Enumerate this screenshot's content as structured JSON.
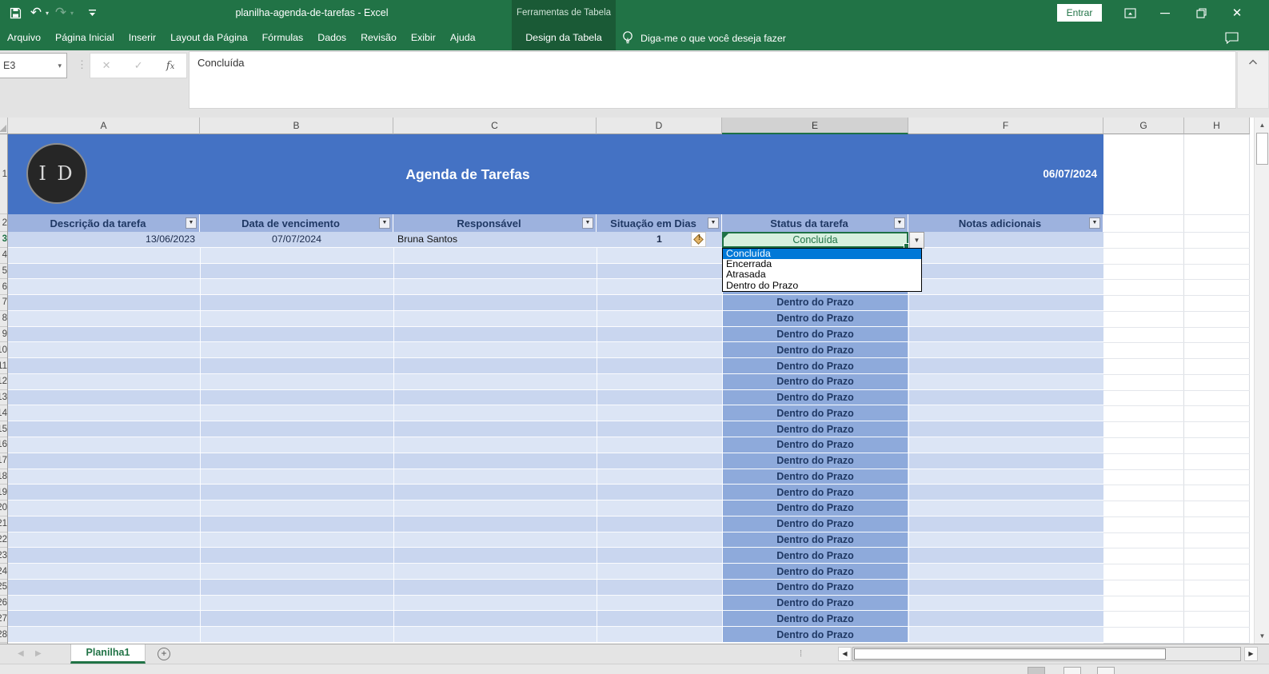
{
  "window": {
    "title": "planilha-agenda-de-tarefas  -  Excel",
    "sign_in_label": "Entrar",
    "contextual_tool_title": "Ferramentas de Tabela"
  },
  "quick_access": {
    "icons": [
      "save-icon",
      "undo-icon",
      "redo-icon",
      "customize-quick-access-icon"
    ]
  },
  "ribbon": {
    "tabs": [
      "Arquivo",
      "Página Inicial",
      "Inserir",
      "Layout da Página",
      "Fórmulas",
      "Dados",
      "Revisão",
      "Exibir",
      "Ajuda"
    ],
    "contextual_tab": "Design da Tabela",
    "tell_me": "Diga-me o que você deseja fazer"
  },
  "formula_bar": {
    "name_box": "E3",
    "value": "Concluída"
  },
  "sheet": {
    "columns": [
      "A",
      "B",
      "C",
      "D",
      "E",
      "F",
      "G",
      "H"
    ],
    "selected_column": "E",
    "first_row": 1,
    "last_row": 28,
    "selected_row": 3,
    "selected_cell": "E3",
    "banner": {
      "logo_text": "I D",
      "title": "Agenda de Tarefas",
      "date": "06/07/2024"
    },
    "table": {
      "headers": [
        "Descrição da tarefa",
        "Data de vencimento",
        "Responsável",
        "Situação em Dias",
        "Status da tarefa",
        "Notas adicionais"
      ],
      "row3": {
        "start_date": "13/06/2023",
        "due_date": "07/07/2024",
        "responsible": "Bruna Santos",
        "days": "1",
        "status": "Concluída"
      },
      "repeated_status": {
        "from_row": 6,
        "to_row": 28,
        "value": "Dentro do Prazo"
      }
    },
    "validation_dropdown": {
      "options": [
        "Concluída",
        "Encerrada",
        "Atrasada",
        "Dentro do Prazo"
      ],
      "highlighted": "Concluída"
    }
  },
  "sheet_tabs": {
    "active_tab": "Planilha1"
  },
  "status_bar": {
    "view_icons": [
      "normal-view-icon",
      "page-layout-view-icon",
      "page-break-preview-icon"
    ]
  },
  "colors": {
    "excel_green": "#217346",
    "contextual_green": "#1A5A36",
    "banner_blue": "#4472C4",
    "table_header_blue": "#9DB2DE",
    "band_dark": "#C9D6EF",
    "band_light": "#DCE5F5",
    "status_cell_blue": "#8EAADB",
    "navy_text": "#1F3864",
    "selected_cell_fill": "#D7F0DE",
    "selected_cell_green": "#1E7145",
    "dropdown_highlight": "#0078D7"
  }
}
